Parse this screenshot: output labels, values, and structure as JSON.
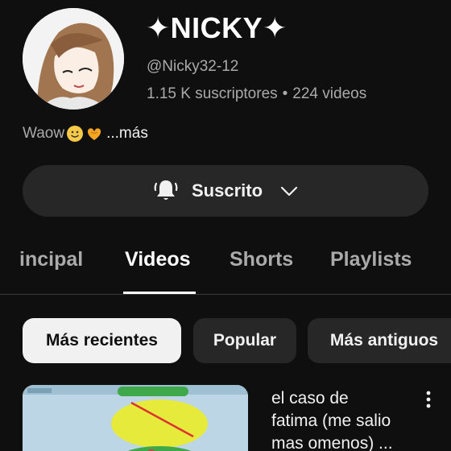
{
  "channel": {
    "name": "✦NICKY✦",
    "handle": "@Nicky32-12",
    "subscribers": "1.15 K suscriptores",
    "separator": "•",
    "videos_count": "224 videos",
    "description": "Waow",
    "more_label": "...más"
  },
  "subscribe": {
    "label": "Suscrito"
  },
  "tabs": [
    {
      "label": "incipal"
    },
    {
      "label": "Videos"
    },
    {
      "label": "Shorts"
    },
    {
      "label": "Playlists"
    }
  ],
  "filters": [
    {
      "label": "Más recientes"
    },
    {
      "label": "Popular"
    },
    {
      "label": "Más antiguos"
    }
  ],
  "videos": [
    {
      "title_lines": [
        "el caso de",
        "fatima (me salio",
        "mas omenos) ..."
      ]
    }
  ],
  "colors": {
    "background": "#0f0f0f",
    "surface": "#272727",
    "text_primary": "#f1f1f1",
    "text_secondary": "#aaaaaa",
    "chip_selected": "#f1f1f1"
  },
  "icons": [
    "bell-ringing-icon",
    "chevron-down-icon",
    "more-vert-icon",
    "emoji-smile-icon",
    "emoji-heart-hands-icon"
  ]
}
